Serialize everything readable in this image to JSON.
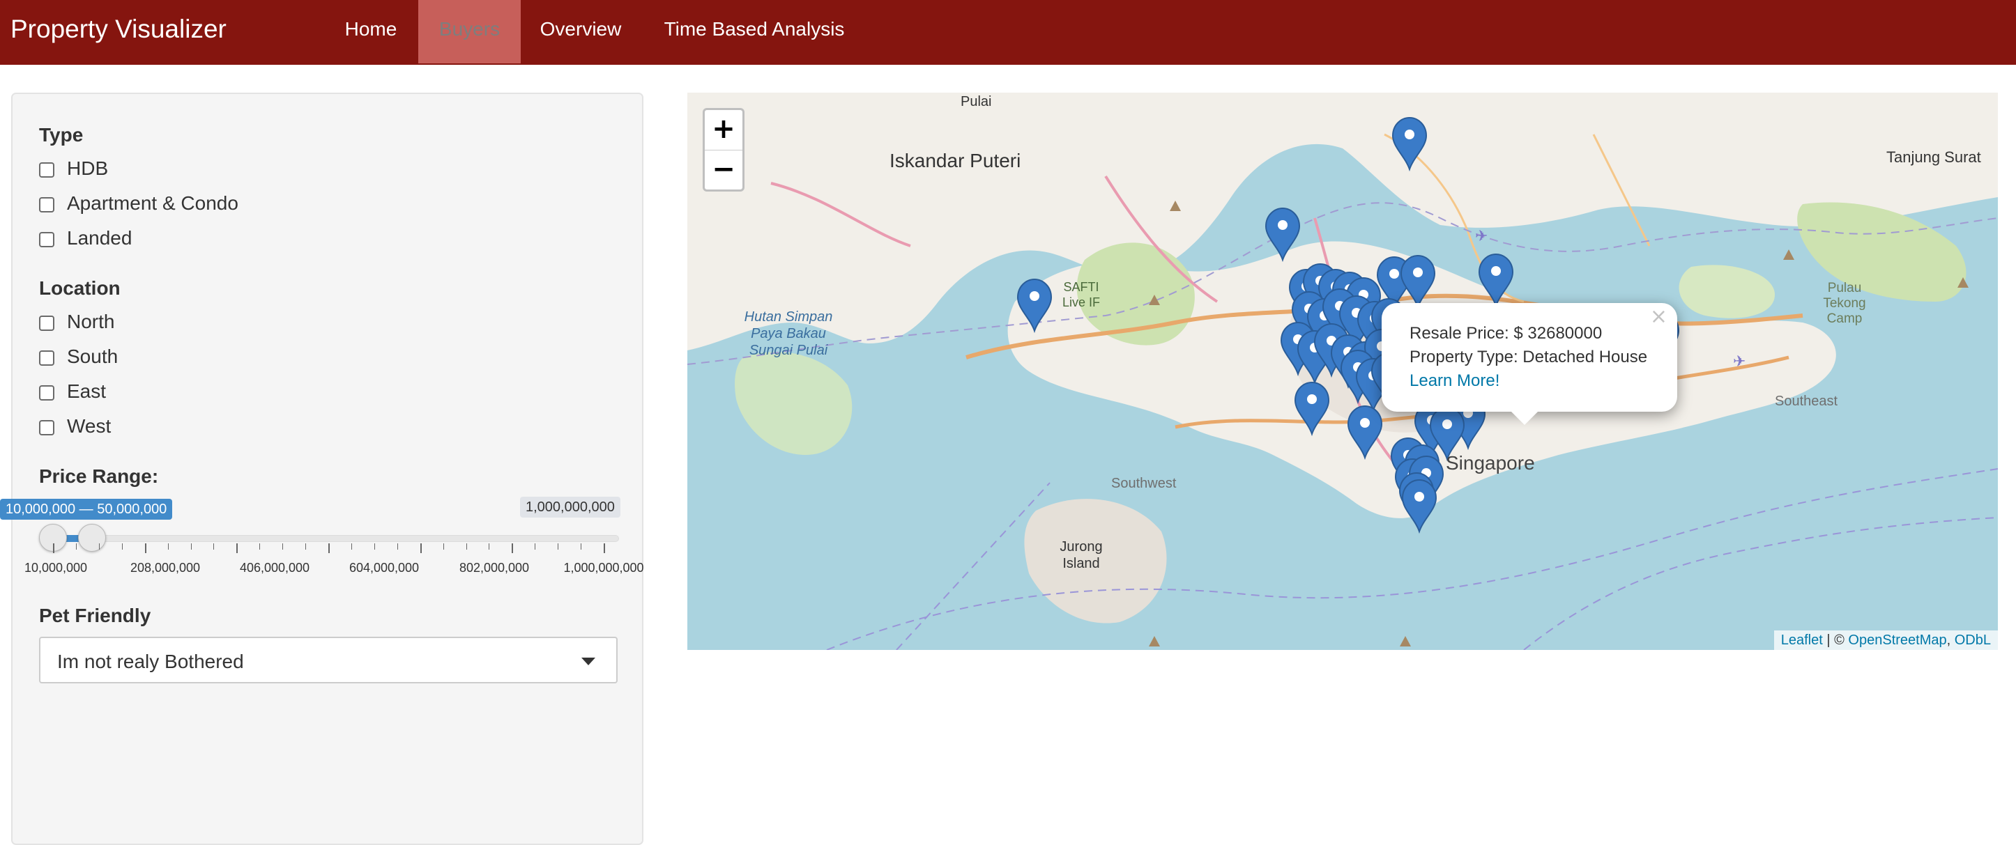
{
  "app": {
    "title": "Property Visualizer"
  },
  "nav": [
    {
      "label": "Home",
      "active": false
    },
    {
      "label": "Buyers",
      "active": true
    },
    {
      "label": "Overview",
      "active": false
    },
    {
      "label": "Time Based Analysis",
      "active": false
    }
  ],
  "filters": {
    "type": {
      "label": "Type",
      "options": [
        {
          "label": "HDB",
          "checked": false
        },
        {
          "label": "Apartment & Condo",
          "checked": false
        },
        {
          "label": "Landed",
          "checked": false
        }
      ]
    },
    "location": {
      "label": "Location",
      "options": [
        {
          "label": "North",
          "checked": false
        },
        {
          "label": "South",
          "checked": false
        },
        {
          "label": "East",
          "checked": false
        },
        {
          "label": "West",
          "checked": false
        }
      ]
    },
    "price": {
      "label": "Price Range:",
      "selected_label": "10,000,000 — 50,000,000",
      "max_label": "1,000,000,000",
      "min": 10000000,
      "max": 1000000000,
      "selected_from": 10000000,
      "selected_to": 50000000,
      "tick_labels": [
        "10,000,000",
        "208,000,000",
        "406,000,000",
        "604,000,000",
        "802,000,000",
        "1,000,000,000"
      ]
    },
    "pet": {
      "label": "Pet Friendly",
      "selected": "Im not realy Bothered"
    }
  },
  "map": {
    "zoom_in": "+",
    "zoom_out": "−",
    "popup": {
      "close": "×",
      "price_line": "Resale Price: $ 32680000",
      "type_line": "Property Type: Detached House",
      "link": "Learn More!"
    },
    "attribution": {
      "leaflet": "Leaflet",
      "sep": " | © ",
      "osm": "OpenStreetMap",
      "comma": ", ",
      "odbl": "ODbL"
    },
    "labels": {
      "iskandar": "Iskandar Puteri",
      "pulai": "Pulai",
      "tanjung": "Tanjung Surat",
      "tekong": "Pulau Tekong Camp",
      "hutan": "Hutan Simpan Paya Bakau Sungai Pulai",
      "safti": "SAFTI Live IF",
      "southwest": "Southwest",
      "southeast": "Southeast",
      "jurong": "Jurong Island",
      "singapore": "Singapore"
    },
    "marker_color": "#3a7bc8"
  }
}
